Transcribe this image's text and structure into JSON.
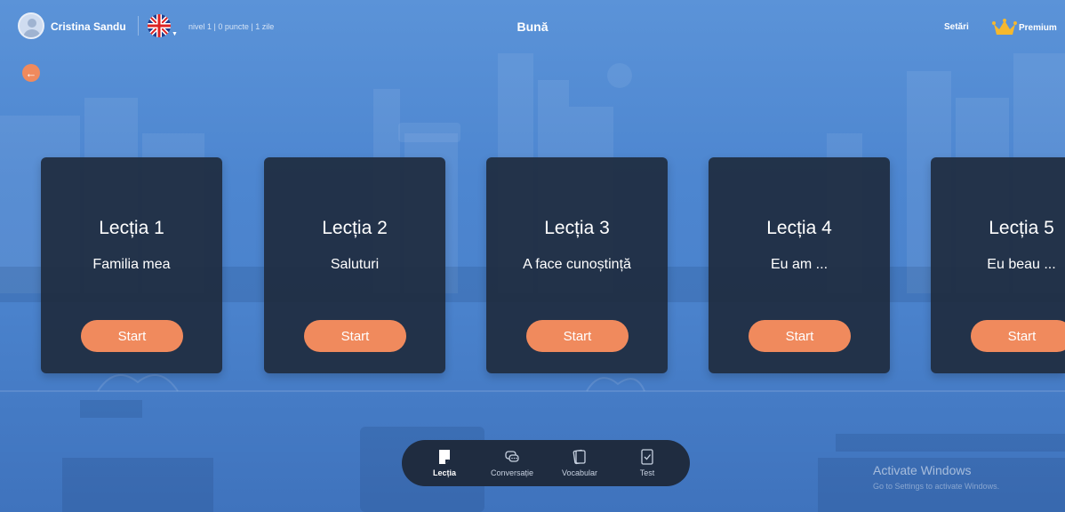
{
  "header": {
    "username": "Cristina Sandu",
    "stats": "nivel 1  |  0 puncte  |  1 zile",
    "page_title": "Bună",
    "settings_label": "Setări",
    "premium_label": "Premium",
    "language_flag": "uk-flag-icon"
  },
  "back_icon": "arrow-left-icon",
  "lessons": [
    {
      "title": "Lecția 1",
      "subtitle": "Familia mea",
      "button": "Start"
    },
    {
      "title": "Lecția 2",
      "subtitle": "Saluturi",
      "button": "Start"
    },
    {
      "title": "Lecția 3",
      "subtitle": "A face cunoștință",
      "button": "Start"
    },
    {
      "title": "Lecția 4",
      "subtitle": "Eu am ...",
      "button": "Start"
    },
    {
      "title": "Lecția 5",
      "subtitle": "Eu beau ...",
      "button": "Start"
    }
  ],
  "bottom_nav": [
    {
      "label": "Lecția",
      "icon": "lesson-icon",
      "active": true
    },
    {
      "label": "Conversație",
      "icon": "chat-icon",
      "active": false
    },
    {
      "label": "Vocabular",
      "icon": "cards-icon",
      "active": false
    },
    {
      "label": "Test",
      "icon": "checklist-icon",
      "active": false
    }
  ],
  "watermark": {
    "title": "Activate Windows",
    "subtitle": "Go to Settings to activate Windows."
  },
  "colors": {
    "accent": "#f08a5d",
    "card_bg": "#1f2c40",
    "background": "#4d86d0"
  }
}
